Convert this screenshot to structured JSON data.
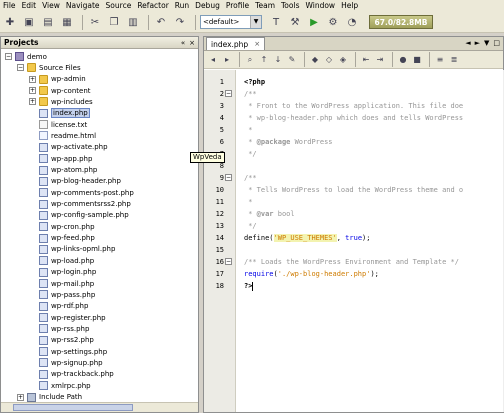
{
  "menu": [
    "File",
    "Edit",
    "View",
    "Navigate",
    "Source",
    "Refactor",
    "Run",
    "Debug",
    "Profile",
    "Team",
    "Tools",
    "Window",
    "Help"
  ],
  "toolbar": {
    "config_value": "<default>",
    "memory": "67.0/82.8MB"
  },
  "projects_panel": {
    "title": "Projects",
    "controls": [
      "«",
      "×"
    ],
    "tree": [
      {
        "label": "demo",
        "indent": 0,
        "icon": "proj",
        "toggle": "−"
      },
      {
        "label": "Source Files",
        "indent": 1,
        "icon": "folder",
        "toggle": "−"
      },
      {
        "label": "wp-admin",
        "indent": 2,
        "icon": "folder",
        "toggle": "+"
      },
      {
        "label": "wp-content",
        "indent": 2,
        "icon": "folder",
        "toggle": "+"
      },
      {
        "label": "wp-includes",
        "indent": 2,
        "icon": "folder",
        "toggle": "+"
      },
      {
        "label": "index.php",
        "indent": 2,
        "icon": "php",
        "selected": true
      },
      {
        "label": "license.txt",
        "indent": 2,
        "icon": "txt"
      },
      {
        "label": "readme.html",
        "indent": 2,
        "icon": "html"
      },
      {
        "label": "wp-activate.php",
        "indent": 2,
        "icon": "php"
      },
      {
        "label": "wp-app.php",
        "indent": 2,
        "icon": "php"
      },
      {
        "label": "wp-atom.php",
        "indent": 2,
        "icon": "php"
      },
      {
        "label": "wp-blog-header.php",
        "indent": 2,
        "icon": "php"
      },
      {
        "label": "wp-comments-post.php",
        "indent": 2,
        "icon": "php"
      },
      {
        "label": "wp-commentsrss2.php",
        "indent": 2,
        "icon": "php"
      },
      {
        "label": "wp-config-sample.php",
        "indent": 2,
        "icon": "php"
      },
      {
        "label": "wp-cron.php",
        "indent": 2,
        "icon": "php"
      },
      {
        "label": "wp-feed.php",
        "indent": 2,
        "icon": "php"
      },
      {
        "label": "wp-links-opml.php",
        "indent": 2,
        "icon": "php"
      },
      {
        "label": "wp-load.php",
        "indent": 2,
        "icon": "php"
      },
      {
        "label": "wp-login.php",
        "indent": 2,
        "icon": "php"
      },
      {
        "label": "wp-mail.php",
        "indent": 2,
        "icon": "php"
      },
      {
        "label": "wp-pass.php",
        "indent": 2,
        "icon": "php"
      },
      {
        "label": "wp-rdf.php",
        "indent": 2,
        "icon": "php"
      },
      {
        "label": "wp-register.php",
        "indent": 2,
        "icon": "php"
      },
      {
        "label": "wp-rss.php",
        "indent": 2,
        "icon": "php"
      },
      {
        "label": "wp-rss2.php",
        "indent": 2,
        "icon": "php"
      },
      {
        "label": "wp-settings.php",
        "indent": 2,
        "icon": "php"
      },
      {
        "label": "wp-signup.php",
        "indent": 2,
        "icon": "php"
      },
      {
        "label": "wp-trackback.php",
        "indent": 2,
        "icon": "php"
      },
      {
        "label": "xmlrpc.php",
        "indent": 2,
        "icon": "php"
      },
      {
        "label": "Include Path",
        "indent": 1,
        "icon": "inc",
        "toggle": "+"
      }
    ]
  },
  "tooltip": "WpVeda",
  "editor": {
    "tab_label": "index.php",
    "tab_controls": [
      "◄",
      "►",
      "▼",
      "□"
    ],
    "lines": [
      {
        "n": "1",
        "parts": [
          [
            "tk-php",
            "<?php"
          ]
        ]
      },
      {
        "n": "2",
        "fold": "−",
        "parts": [
          [
            "tk-cm",
            "/**"
          ]
        ]
      },
      {
        "n": "3",
        "parts": [
          [
            "tk-cm",
            " * Front to the WordPress application. This file doe"
          ]
        ]
      },
      {
        "n": "4",
        "parts": [
          [
            "tk-cm",
            " * wp-blog-header.php which does and tells WordPress"
          ]
        ]
      },
      {
        "n": "5",
        "parts": [
          [
            "tk-cm",
            " *"
          ]
        ]
      },
      {
        "n": "6",
        "parts": [
          [
            "tk-cm",
            " * "
          ],
          [
            "tk-tag",
            "@package"
          ],
          [
            "tk-cm",
            " WordPress"
          ]
        ]
      },
      {
        "n": "7",
        "parts": [
          [
            "tk-cm",
            " */"
          ]
        ]
      },
      {
        "n": "8",
        "parts": []
      },
      {
        "n": "9",
        "fold": "−",
        "parts": [
          [
            "tk-cm",
            "/**"
          ]
        ]
      },
      {
        "n": "10",
        "parts": [
          [
            "tk-cm",
            " * Tells WordPress to load the WordPress theme and o"
          ]
        ]
      },
      {
        "n": "11",
        "parts": [
          [
            "tk-cm",
            " *"
          ]
        ]
      },
      {
        "n": "12",
        "parts": [
          [
            "tk-cm",
            " * "
          ],
          [
            "tk-tag",
            "@var"
          ],
          [
            "tk-cm",
            " bool"
          ]
        ]
      },
      {
        "n": "13",
        "parts": [
          [
            "tk-cm",
            " */"
          ]
        ]
      },
      {
        "n": "14",
        "parts": [
          [
            "tk-fn",
            "define("
          ],
          [
            "tk-str2",
            "'WP_USE_THEMES'"
          ],
          [
            "tk-fn",
            ", "
          ],
          [
            "tk-kw",
            "true"
          ],
          [
            "tk-fn",
            ");"
          ]
        ]
      },
      {
        "n": "15",
        "parts": []
      },
      {
        "n": "16",
        "fold": "−",
        "parts": [
          [
            "tk-cm",
            "/** Loads the WordPress Environment and Template */"
          ]
        ]
      },
      {
        "n": "17",
        "parts": [
          [
            "tk-kw",
            "require"
          ],
          [
            "tk-fn",
            "("
          ],
          [
            "tk-str",
            "'./wp-blog-header.php'"
          ],
          [
            "tk-fn",
            ");"
          ]
        ]
      },
      {
        "n": "18",
        "parts": [
          [
            "tk-php",
            "?>"
          ]
        ],
        "caret": true
      }
    ]
  }
}
